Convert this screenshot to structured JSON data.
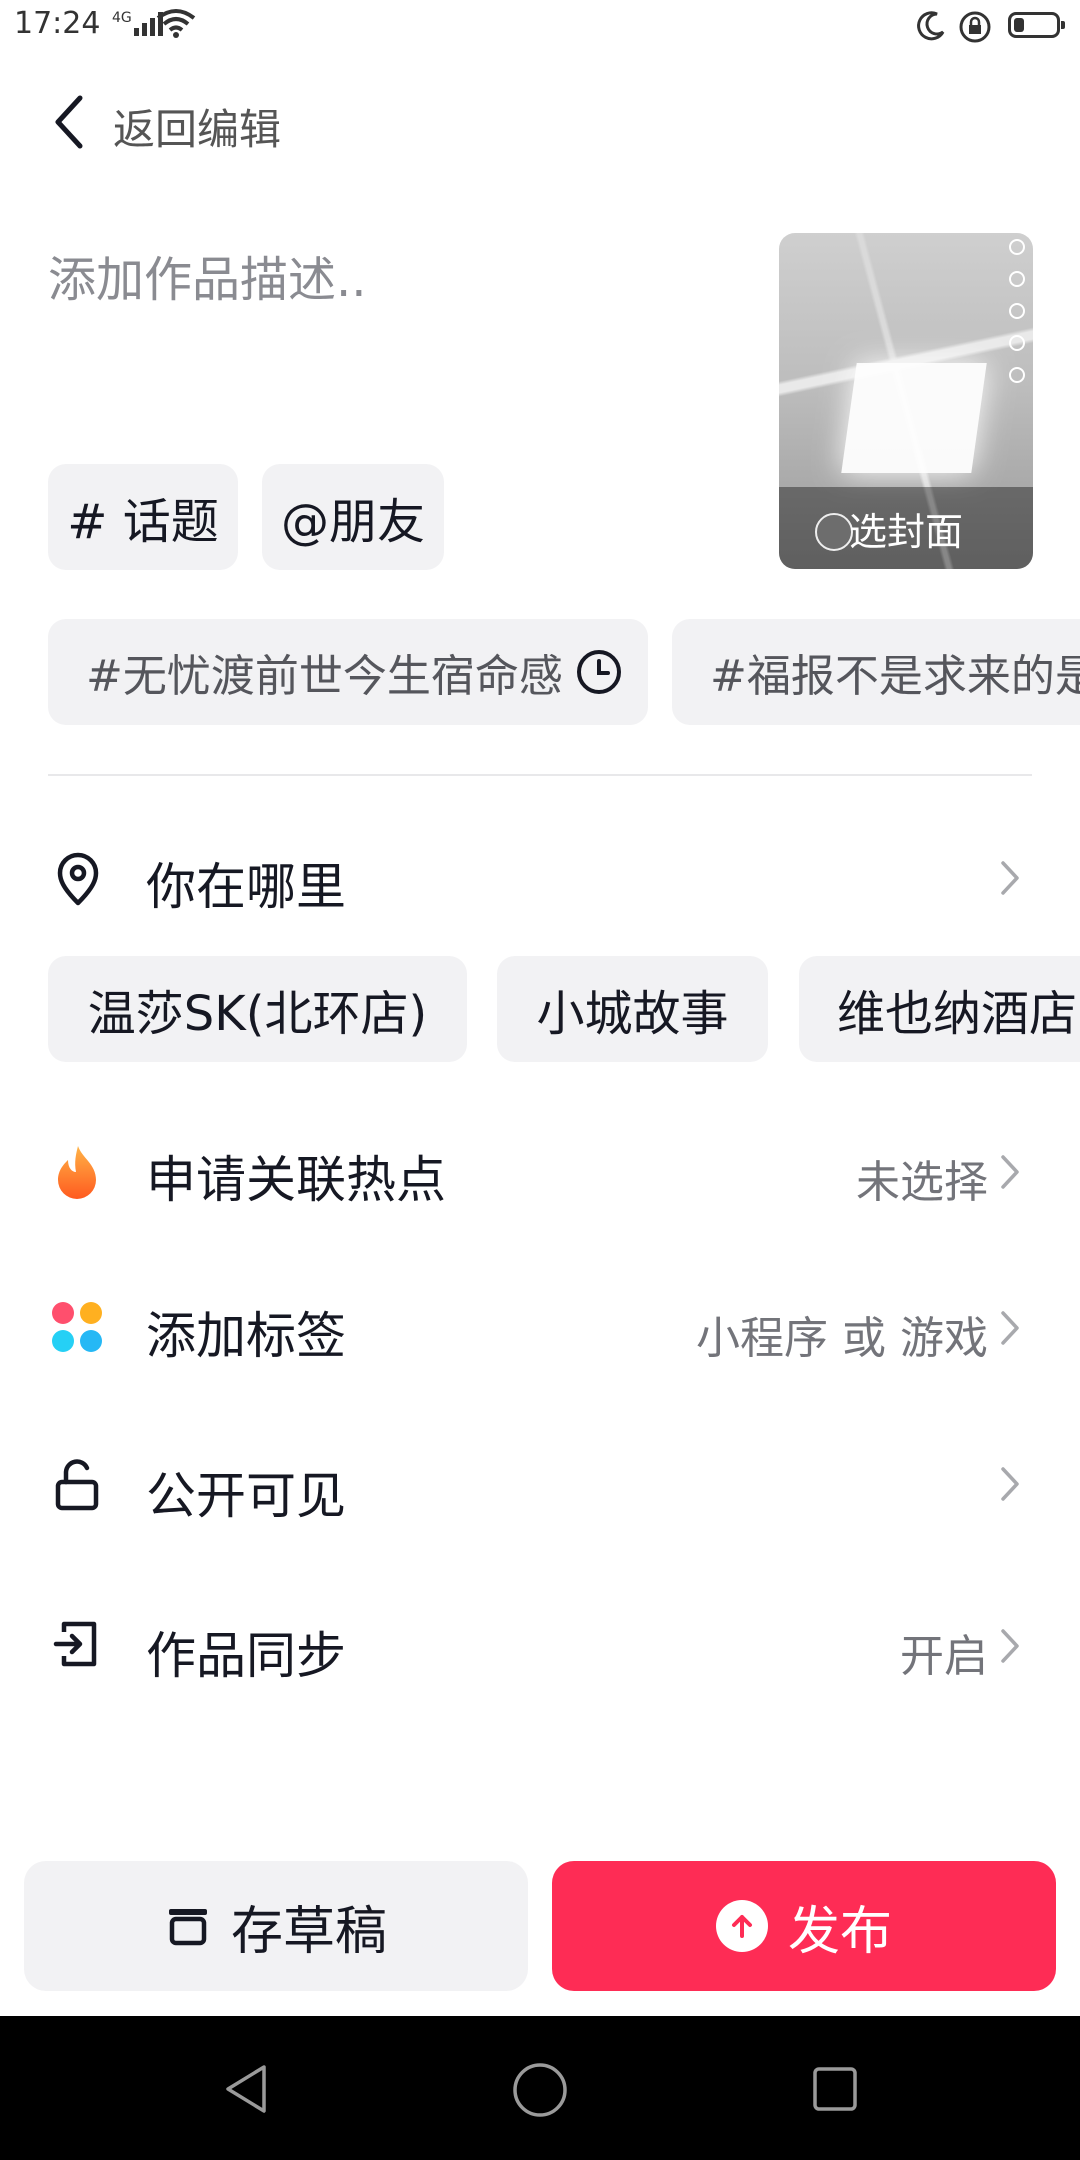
{
  "status_bar": {
    "time": "17:24",
    "network": "4G"
  },
  "header": {
    "back_label": "返回编辑"
  },
  "description": {
    "placeholder": "添加作品描述.."
  },
  "cover": {
    "label": "选封面"
  },
  "chips": {
    "topic": "# 话题",
    "friend": "@朋友"
  },
  "hashtags": [
    {
      "text": "#无忧渡前世今生宿命感"
    },
    {
      "text": "#福报不是求来的是"
    }
  ],
  "location": {
    "label": "你在哪里",
    "suggestions": [
      "温莎SK(北环店)",
      "小城故事",
      "维也纳酒店"
    ]
  },
  "hotspot": {
    "label": "申请关联热点",
    "value": "未选择"
  },
  "tags": {
    "label": "添加标签",
    "value": "小程序 或 游戏"
  },
  "visibility": {
    "label": "公开可见"
  },
  "sync": {
    "label": "作品同步",
    "value": "开启"
  },
  "actions": {
    "draft_label": "存草稿",
    "publish_label": "发布"
  },
  "colors": {
    "accent": "#fe2c55",
    "chip_bg": "#f2f2f4"
  }
}
